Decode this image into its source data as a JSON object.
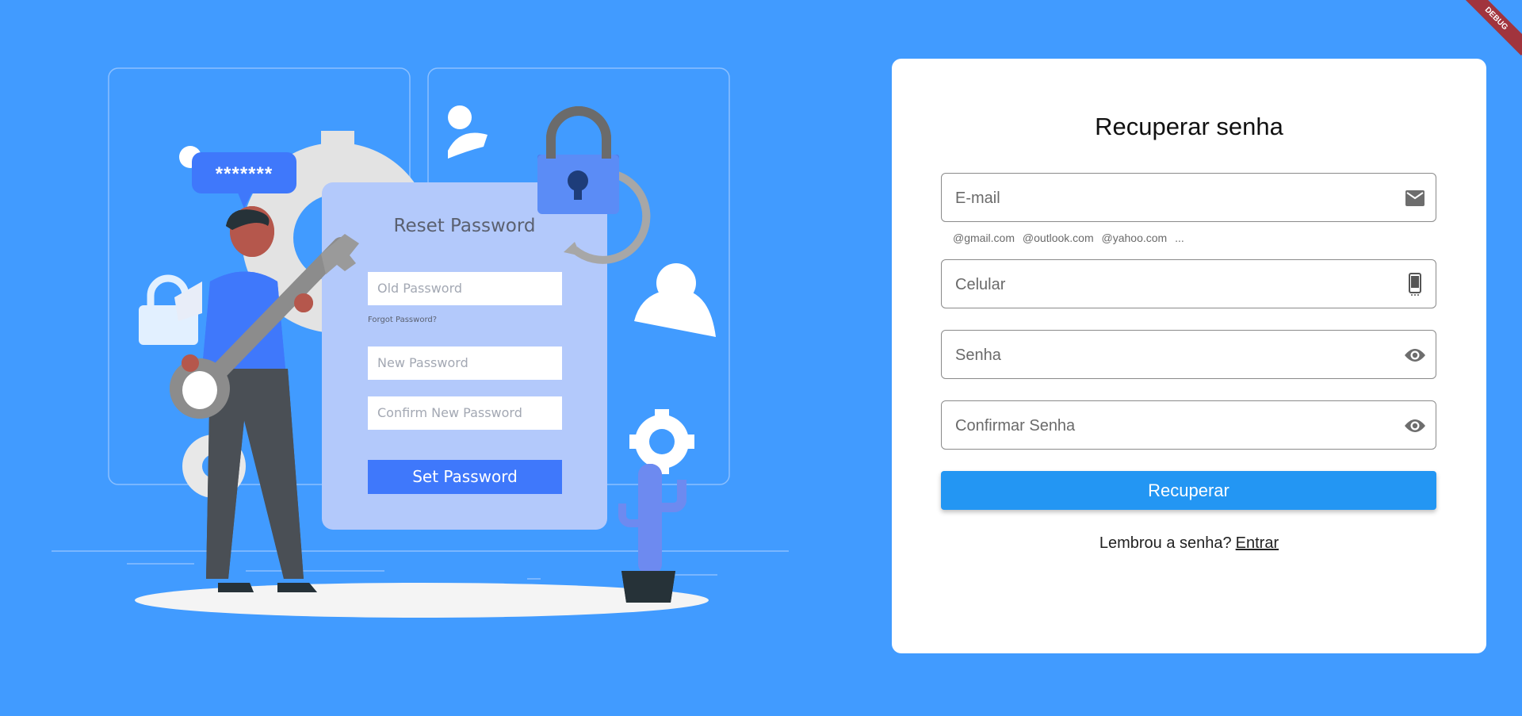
{
  "illustration": {
    "bubble_text": "*******",
    "card_title": "Reset Password",
    "old_password_placeholder": "Old Password",
    "forgot_text": "Forgot Password?",
    "new_password_placeholder": "New Password",
    "confirm_password_placeholder": "Confirm New Password",
    "set_button": "Set Password"
  },
  "form": {
    "title": "Recuperar senha",
    "email_label": "E-mail",
    "email_suggestions": [
      "@gmail.com",
      "@outlook.com",
      "@yahoo.com",
      "..."
    ],
    "phone_label": "Celular",
    "password_label": "Senha",
    "confirm_password_label": "Confirmar Senha",
    "submit_label": "Recuperar",
    "footer_prompt": "Lembrou a senha?",
    "footer_link": "Entrar"
  },
  "debug_banner": "DEBUG",
  "colors": {
    "background": "#419bff",
    "primary": "#2396f3",
    "card": "#ffffff",
    "illustration_accent": "#3f78fb",
    "debug_banner": "#a1343d"
  },
  "icons": {
    "email": "mail-icon",
    "phone": "phone-icon",
    "password": "eye-icon",
    "confirm_password": "eye-icon"
  }
}
